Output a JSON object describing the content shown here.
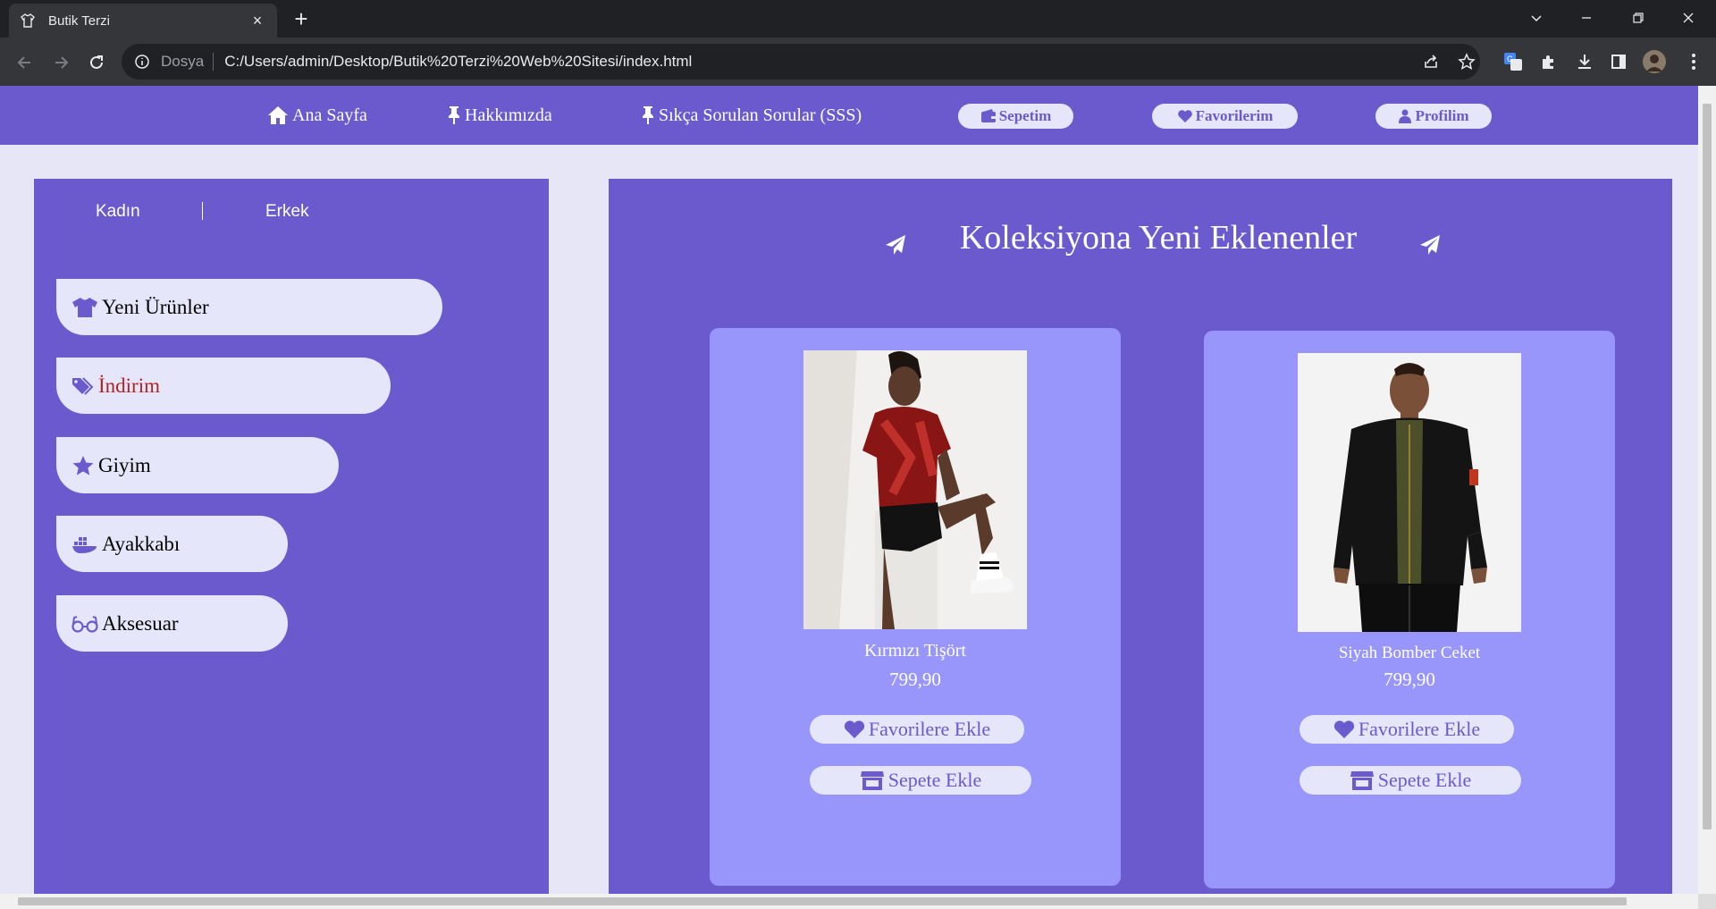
{
  "browser": {
    "tab_title": "Butik Terzi",
    "new_tab_label": "+",
    "close_tab_label": "×",
    "address_scheme": "Dosya",
    "address_url": "C:/Users/admin/Desktop/Butik%20Terzi%20Web%20Sitesi/index.html",
    "icons": [
      "shirt-favicon",
      "back-icon",
      "forward-icon",
      "reload-icon",
      "info-icon",
      "share-icon",
      "star-icon",
      "translate-icon",
      "extensions-icon",
      "download-icon",
      "sidepanel-icon",
      "profile-avatar",
      "menu-icon",
      "tab-list-icon",
      "minimize-icon",
      "restore-icon",
      "close-window-icon"
    ]
  },
  "navbar": {
    "home": "Ana Sayfa",
    "about": "Hakkımızda",
    "faq": "Sıkça Sorulan Sorular (SSS)",
    "cart": "Sepetim",
    "favorites": "Favorilerim",
    "profile": "Profilim"
  },
  "sidebar": {
    "women": "Kadın",
    "men": "Erkek",
    "categories": [
      {
        "label": "Yeni Ürünler",
        "icon": "tshirt-icon"
      },
      {
        "label": "İndirim",
        "icon": "tags-icon"
      },
      {
        "label": "Giyim",
        "icon": "star-icon"
      },
      {
        "label": "Ayakkabı",
        "icon": "shoe-icon"
      },
      {
        "label": "Aksesuar",
        "icon": "glasses-icon"
      }
    ]
  },
  "main": {
    "title": "Koleksiyona Yeni Eklenenler",
    "products": [
      {
        "name": "Kırmızı Tişört",
        "price": "799,90",
        "fav_label": "Favorilere Ekle",
        "cart_label": "Sepete Ekle"
      },
      {
        "name": "Siyah Bomber Ceket",
        "price": "799,90",
        "fav_label": "Favorilere Ekle",
        "cart_label": "Sepete Ekle"
      }
    ]
  },
  "colors": {
    "primary": "#6a5acd",
    "light": "#e6e6fa",
    "card": "#9896fa",
    "sale": "#b22222"
  }
}
